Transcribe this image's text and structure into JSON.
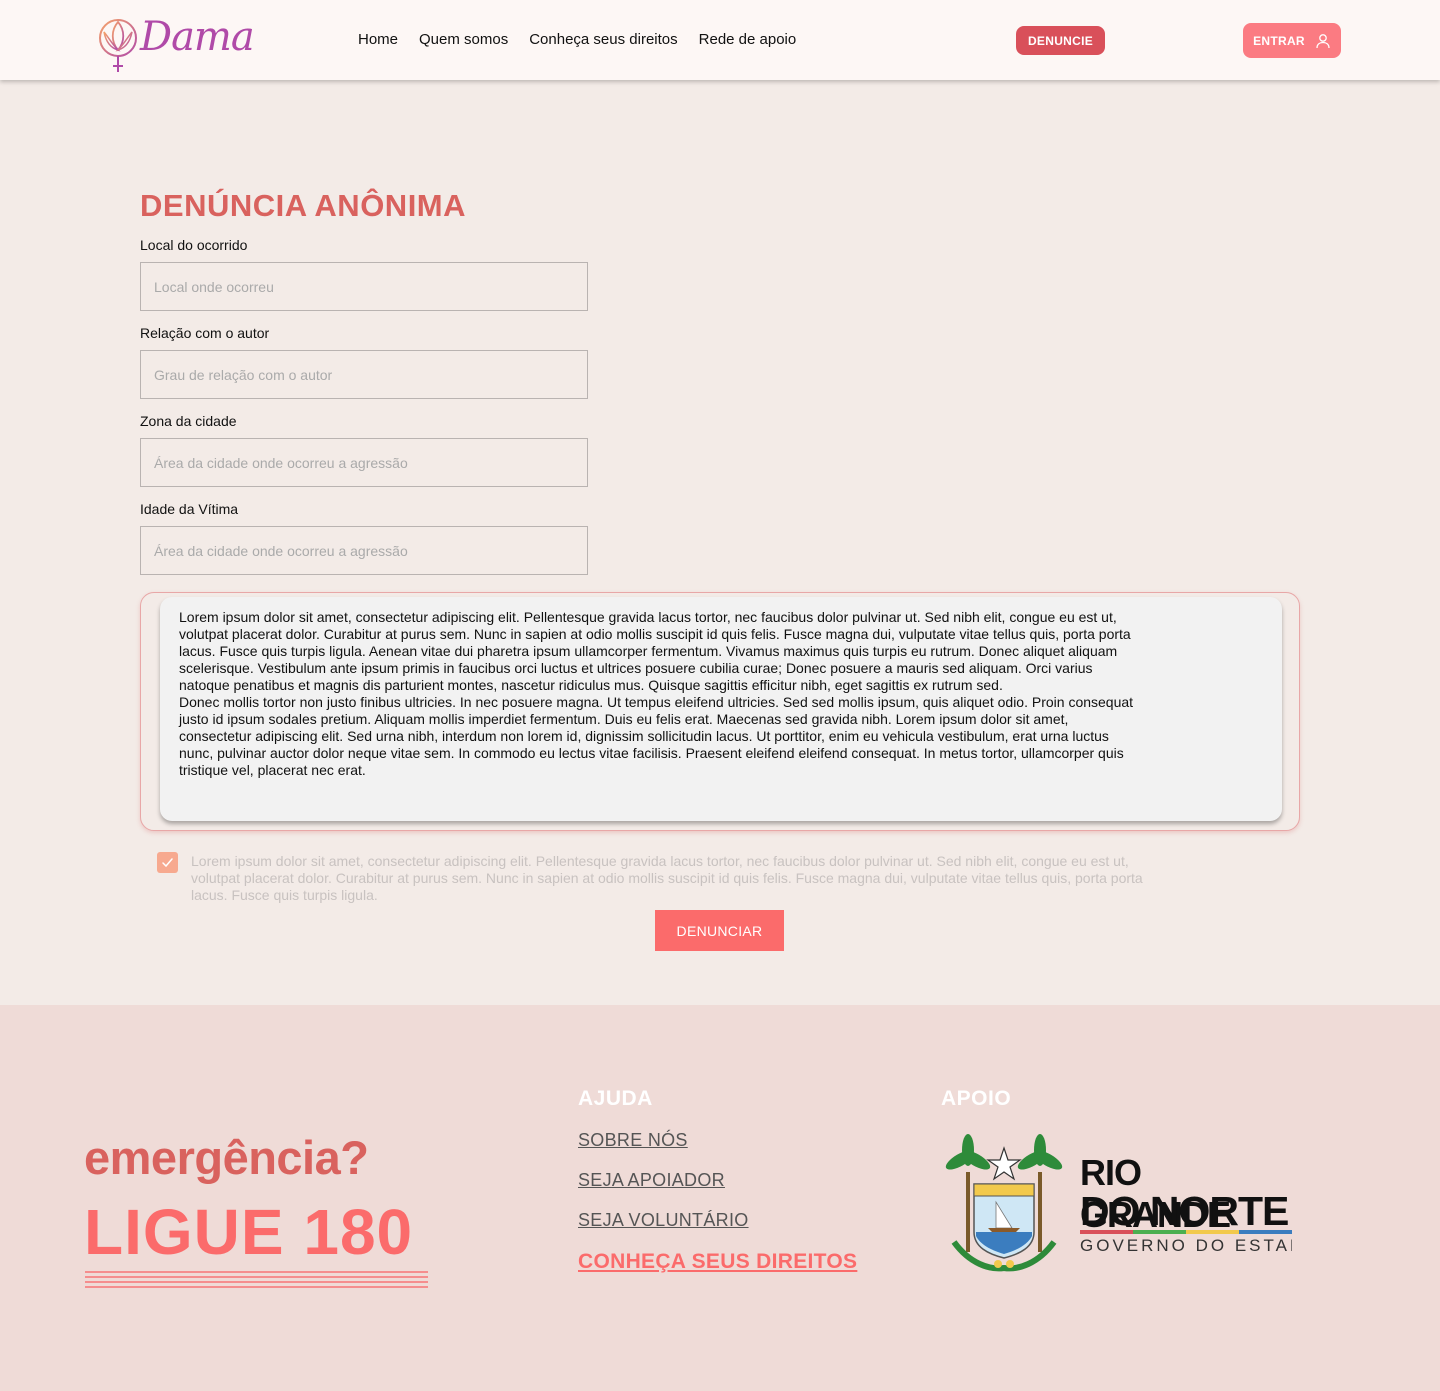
{
  "header": {
    "logo_text": "Dama",
    "nav": [
      "Home",
      "Quem somos",
      "Conheça seus direitos",
      "Rede de apoio"
    ],
    "denuncie_label": "DENUNCIE",
    "entrar_label": "ENTRAR"
  },
  "form": {
    "title": "DENÚNCIA ANÔNIMA",
    "fields": [
      {
        "label": "Local do ocorrido",
        "placeholder": "Local onde ocorreu"
      },
      {
        "label": "Relação com o autor",
        "placeholder": "Grau de relação com o autor"
      },
      {
        "label": "Zona da cidade",
        "placeholder": "Área da cidade onde ocorreu a agressão"
      },
      {
        "label": "Idade da Vítima",
        "placeholder": "Área da cidade onde ocorreu a agressão"
      }
    ],
    "description_p1": "Lorem ipsum dolor sit amet, consectetur adipiscing elit. Pellentesque gravida lacus tortor, nec faucibus dolor pulvinar ut. Sed nibh elit, congue eu est ut, volutpat placerat dolor. Curabitur at purus sem. Nunc in sapien at odio mollis suscipit id quis felis. Fusce magna dui, vulputate vitae tellus quis, porta porta lacus. Fusce quis turpis ligula. Aenean vitae dui pharetra ipsum ullamcorper fermentum. Vivamus maximus quis turpis eu rutrum. Donec aliquet aliquam scelerisque. Vestibulum ante ipsum primis in faucibus orci luctus et ultrices posuere cubilia curae; Donec posuere a mauris sed aliquam. Orci varius natoque penatibus et magnis dis parturient montes, nascetur ridiculus mus. Quisque sagittis efficitur nibh, eget sagittis ex rutrum sed.",
    "description_p2": "Donec mollis tortor non justo finibus ultricies. In nec posuere magna. Ut tempus eleifend ultricies. Sed sed mollis ipsum, quis aliquet odio. Proin consequat justo id ipsum sodales pretium. Aliquam mollis imperdiet fermentum. Duis eu felis erat. Maecenas sed gravida nibh. Lorem ipsum dolor sit amet, consectetur adipiscing elit. Sed urna nibh, interdum non lorem id, dignissim sollicitudin lacus. Ut porttitor, enim eu vehicula vestibulum, erat urna luctus nunc, pulvinar auctor dolor neque vitae sem. In commodo eu lectus vitae facilisis. Praesent eleifend eleifend consequat. In metus tortor, ullamcorper quis tristique vel, placerat nec erat.",
    "checkbox_checked": true,
    "checkbox_text": "Lorem ipsum dolor sit amet, consectetur adipiscing elit. Pellentesque gravida lacus tortor, nec faucibus dolor pulvinar ut. Sed nibh elit, congue eu est ut, volutpat placerat dolor. Curabitur at purus sem. Nunc in sapien at odio mollis suscipit id quis felis. Fusce magna dui, vulputate vitae tellus quis, porta porta lacus. Fusce quis turpis ligula.",
    "submit_label": "DENUNCIAR"
  },
  "footer": {
    "emergency": "emergência?",
    "call": "LIGUE 180",
    "help_title": "AJUDA",
    "help_links": [
      "SOBRE NÓS",
      "SEJA APOIADOR",
      "SEJA VOLUNTÁRIO",
      "CONHEÇA SEUS DIREITOS"
    ],
    "support_title": "APOIO",
    "support_logo_line1": "RIO GRANDE",
    "support_logo_line2": "DO NORTE",
    "support_logo_line3": "GOVERNO DO ESTADO"
  },
  "colors": {
    "accent": "#fb6b6b",
    "title": "#d9625e",
    "denuncie_button": "#d9505a",
    "entrar_button": "#fb7b82",
    "page_bg": "#f3ebe7",
    "footer_bg": "#efdbd7"
  }
}
